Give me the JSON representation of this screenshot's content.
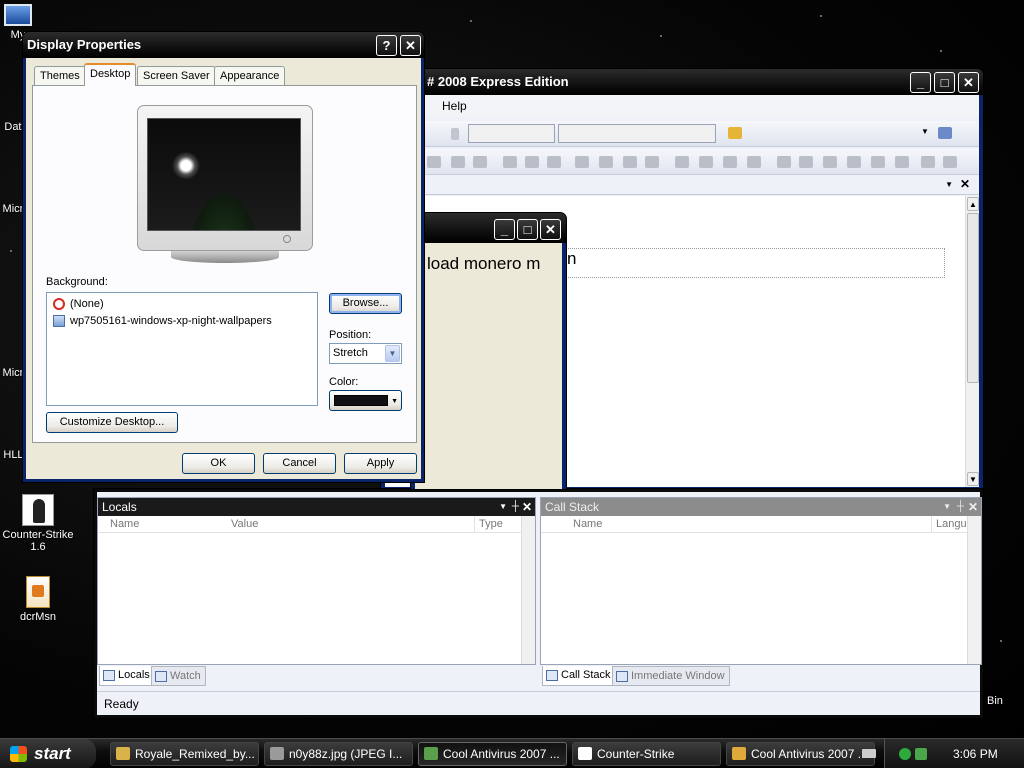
{
  "desktop": {
    "icons": [
      {
        "label": "My"
      },
      {
        "label": "Data"
      },
      {
        "label": "Micro"
      },
      {
        "label": "Micro"
      },
      {
        "label": "HLLI"
      },
      {
        "label": "Counter-Strike 1.6"
      },
      {
        "label": "dcrMsn"
      }
    ],
    "recycle_label": "Bin"
  },
  "vs_window": {
    "title": "# 2008 Express Edition",
    "menu_help": "Help",
    "editor_text": "load monero m",
    "locals": {
      "title": "Locals",
      "columns": [
        "Name",
        "Value",
        "Type"
      ]
    },
    "callstack": {
      "title": "Call Stack",
      "columns": [
        "Name",
        "Langu"
      ]
    },
    "bottom_tabs_left": [
      "Locals",
      "Watch"
    ],
    "bottom_tabs_right": [
      "Call Stack",
      "Immediate Window"
    ],
    "status": "Ready"
  },
  "dialog": {
    "title": "Display Properties",
    "help_btn": "?",
    "close_btn": "✕",
    "tabs": [
      "Themes",
      "Desktop",
      "Screen Saver",
      "Appearance"
    ],
    "background_label": "Background:",
    "background_items": [
      "(None)",
      "wp7505161-windows-xp-night-wallpapers"
    ],
    "browse": "Browse...",
    "position_label": "Position:",
    "position_value": "Stretch",
    "color_label": "Color:",
    "color_value": "#0f0f14",
    "customize": "Customize Desktop...",
    "ok": "OK",
    "cancel": "Cancel",
    "apply": "Apply"
  },
  "taskbar": {
    "start": "start",
    "tasks": [
      "Royale_Remixed_by...",
      "n0y88z.jpg (JPEG I...",
      "Cool Antivirus 2007 ...",
      "Counter-Strike",
      "Cool Antivirus 2007 ..."
    ],
    "clock": "3:06 PM"
  }
}
